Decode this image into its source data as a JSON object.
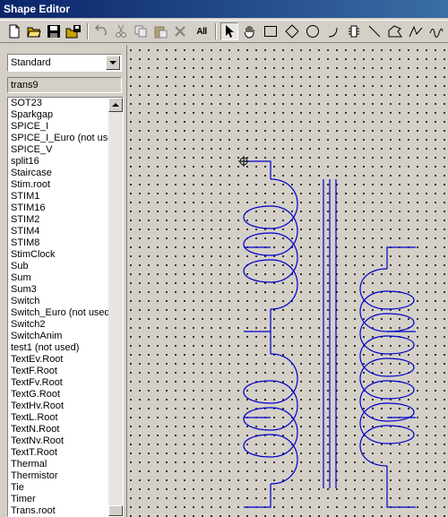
{
  "app": {
    "title": "Shape Editor"
  },
  "toolbar": {
    "tools": [
      {
        "icon": "new-file-icon"
      },
      {
        "icon": "open-folder-icon"
      },
      {
        "icon": "save-icon"
      },
      {
        "icon": "save-all-icon"
      },
      {
        "icon": "undo-icon"
      },
      {
        "icon": "cut-icon"
      },
      {
        "icon": "copy-icon"
      },
      {
        "icon": "paste-icon"
      },
      {
        "icon": "delete-icon"
      },
      {
        "icon": "select-all-icon",
        "label": "All"
      },
      {
        "icon": "pointer-icon",
        "pressed": true
      },
      {
        "icon": "hand-icon"
      },
      {
        "icon": "rectangle-icon"
      },
      {
        "icon": "diamond-icon"
      },
      {
        "icon": "ellipse-icon"
      },
      {
        "icon": "arc-icon"
      },
      {
        "icon": "pin-icon"
      },
      {
        "icon": "line-icon"
      },
      {
        "icon": "polygon-icon"
      },
      {
        "icon": "polyline-icon"
      },
      {
        "icon": "wave-icon"
      }
    ]
  },
  "library": {
    "selected": "Standard"
  },
  "shape_name": {
    "value": "trans9"
  },
  "shape_list": {
    "items": [
      "SOT23",
      "Sparkgap",
      "SPICE_I",
      "SPICE_I_Euro (not used)",
      "SPICE_V",
      "split16",
      "Staircase",
      "Stim.root",
      "STIM1",
      "STIM16",
      "STIM2",
      "STIM4",
      "STIM8",
      "StimClock",
      "Sub",
      "Sum",
      "Sum3",
      "Switch",
      "Switch_Euro (not used)",
      "Switch2",
      "SwitchAnim",
      "test1 (not used)",
      "TextEv.Root",
      "TextF.Root",
      "TextFv.Root",
      "TextG.Root",
      "TextHv.Root",
      "TextL.Root",
      "TextN.Root",
      "TextNv.Root",
      "TextT.Root",
      "Thermal",
      "Thermistor",
      "Tie",
      "Timer",
      "Trans.root"
    ]
  },
  "colors": {
    "title_start": "#0a246a",
    "title_end": "#3a6ea5",
    "chrome": "#d4d0c8",
    "shape_stroke": "#0000cc"
  }
}
